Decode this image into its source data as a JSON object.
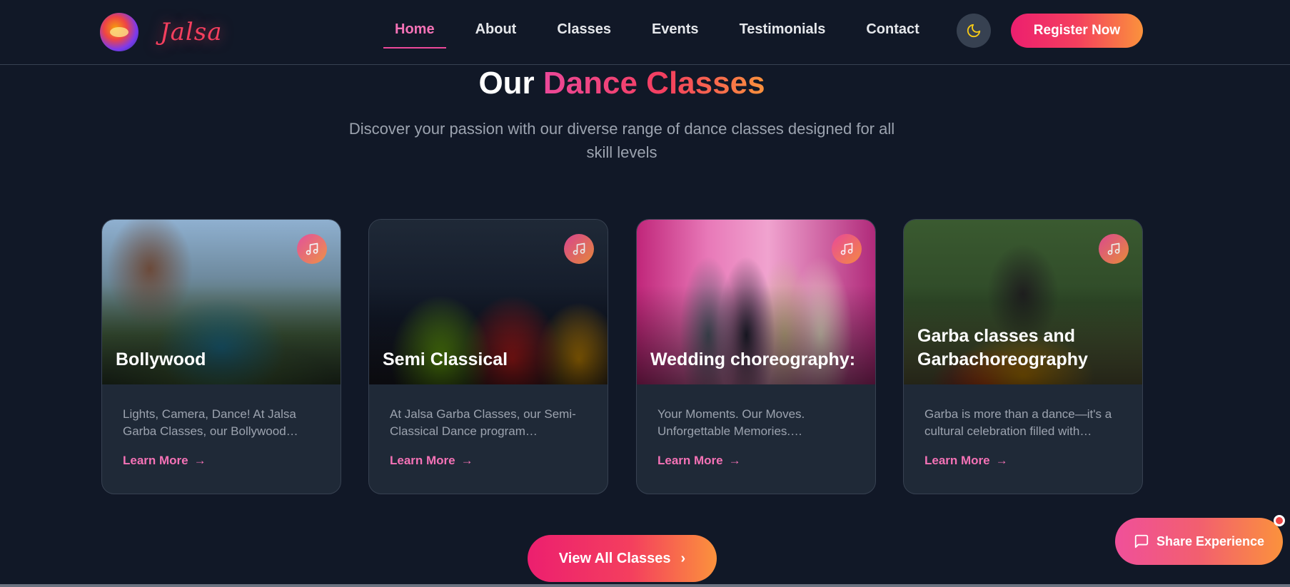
{
  "header": {
    "logo_text": "Jalsa",
    "nav": [
      {
        "label": "Home",
        "active": true
      },
      {
        "label": "About"
      },
      {
        "label": "Classes"
      },
      {
        "label": "Events"
      },
      {
        "label": "Testimonials"
      },
      {
        "label": "Contact"
      }
    ],
    "theme_icon": "moon-icon",
    "register_label": "Register Now"
  },
  "section": {
    "title_plain": "Our ",
    "title_accent": "Dance Classes",
    "subtitle": "Discover your passion with our diverse range of dance classes designed for all skill levels"
  },
  "cards": [
    {
      "title": "Bollywood",
      "text": "Lights, Camera, Dance! At Jalsa Garba Classes, our Bollywood…",
      "link": "Learn More"
    },
    {
      "title": "Semi Classical",
      "text": "At Jalsa Garba Classes, our Semi-Classical Dance program…",
      "link": "Learn More"
    },
    {
      "title": "Wedding choreography:",
      "text": "Your Moments. Our Moves. Unforgettable Memories.…",
      "link": "Learn More"
    },
    {
      "title": "Garba classes and Garbachoreography",
      "text": "Garba is more than a dance—it's a cultural celebration filled with…",
      "link": "Learn More"
    }
  ],
  "view_all_label": "View All Classes",
  "share_label": "Share Experience",
  "colors": {
    "background": "#111827",
    "card": "#1f2937",
    "accent_pink": "#ec4899",
    "accent_orange": "#fb923c"
  }
}
